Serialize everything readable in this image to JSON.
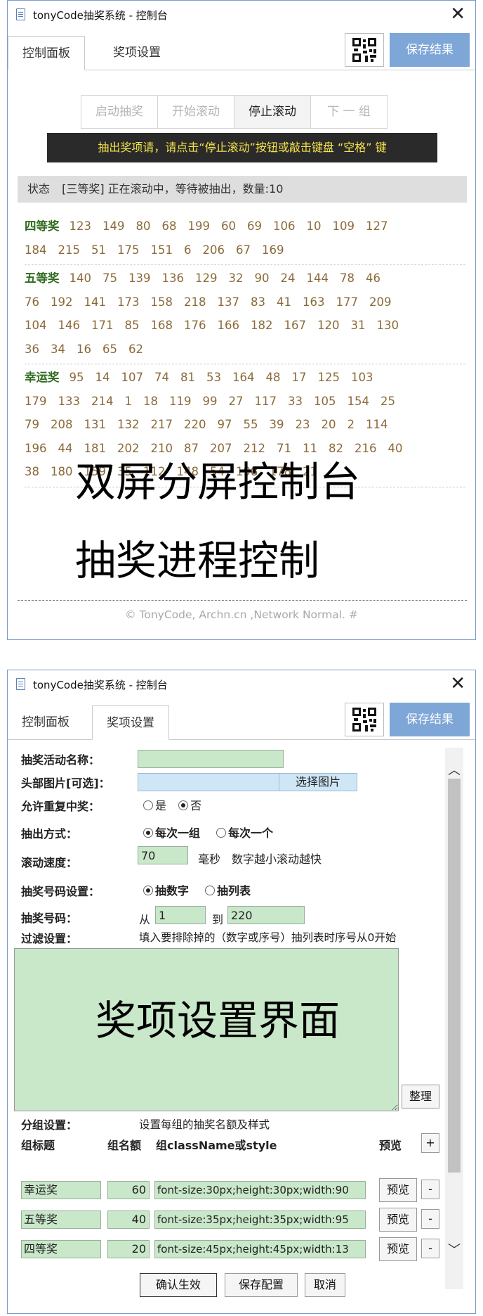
{
  "window_title": "tonyCode抽奖系统 - 控制台",
  "tabs": [
    "控制面板",
    "奖项设置"
  ],
  "save_button": "保存结果",
  "control": {
    "buttons": [
      "启动抽奖",
      "开始滚动",
      "停止滚动",
      "下 一 组"
    ],
    "active_button": "停止滚动",
    "notice": "抽出奖项请，请点击“停止滚动”按钮或敲击键盘 “空格” 键",
    "status_label": "状态",
    "status_text": "[三等奖] 正在滚动中，等待被抽出，数量:10",
    "groups": [
      {
        "name": "四等奖",
        "lines": [
          [
            "123",
            "149",
            "80",
            "68",
            "199",
            "60",
            "69",
            "106",
            "10",
            "109",
            "127"
          ],
          [
            "184",
            "215",
            "51",
            "175",
            "151",
            "6",
            "206",
            "67",
            "169"
          ]
        ]
      },
      {
        "name": "五等奖",
        "lines": [
          [
            "140",
            "75",
            "139",
            "136",
            "129",
            "32",
            "90",
            "24",
            "144",
            "78",
            "46"
          ],
          [
            "76",
            "192",
            "141",
            "173",
            "158",
            "218",
            "137",
            "83",
            "41",
            "163",
            "177",
            "209"
          ],
          [
            "104",
            "146",
            "171",
            "85",
            "168",
            "176",
            "166",
            "182",
            "167",
            "120",
            "31",
            "130"
          ],
          [
            "36",
            "34",
            "16",
            "65",
            "62"
          ]
        ]
      },
      {
        "name": "幸运奖",
        "lines": [
          [
            "95",
            "14",
            "107",
            "74",
            "81",
            "53",
            "164",
            "48",
            "17",
            "125",
            "103"
          ],
          [
            "179",
            "133",
            "214",
            "1",
            "18",
            "119",
            "99",
            "27",
            "117",
            "33",
            "105",
            "154",
            "25"
          ],
          [
            "79",
            "208",
            "131",
            "132",
            "217",
            "220",
            "97",
            "55",
            "39",
            "23",
            "20",
            "2",
            "114"
          ],
          [
            "196",
            "44",
            "181",
            "202",
            "210",
            "87",
            "207",
            "212",
            "71",
            "11",
            "82",
            "216",
            "40"
          ],
          [
            "38",
            "180",
            "159",
            "35",
            "112",
            "148",
            "54",
            "198",
            "178",
            "21"
          ]
        ]
      }
    ],
    "overlay_line1": "双屏分屏控制台",
    "overlay_line2": "抽奖进程控制",
    "footer": "© TonyCode, Archn.cn ,Network Normal. #"
  },
  "settings": {
    "name_label": "抽奖活动名称：",
    "name_value": "",
    "header_image_label": "头部图片[可选]：",
    "choose_image_button": "选择图片",
    "allow_repeat_label": "允许重复中奖：",
    "yes": "是",
    "no": "否",
    "draw_mode_label": "抽出方式：",
    "draw_mode_group": "每次一组",
    "draw_mode_single": "每次一个",
    "speed_label": "滚动速度：",
    "speed_value": "70",
    "speed_unit": "毫秒",
    "speed_hint": "数字越小滚动越快",
    "number_setting_label": "抽奖号码设置：",
    "by_number": "抽数字",
    "by_list": "抽列表",
    "number_label": "抽奖号码：",
    "from": "从",
    "from_value": "1",
    "to": "到",
    "to_value": "220",
    "filter_label": "过滤设置：",
    "filter_hint": "填入要排除掉的（数字或序号）抽列表时序号从0开始",
    "overlay_text": "奖项设置界面",
    "tidy_button": "整理",
    "group_setting_label": "分组设置：",
    "group_setting_hint": "设置每组的抽奖名额及样式",
    "col_title": "组标题",
    "col_quota": "组名额",
    "col_style": "组className或style",
    "col_preview": "预览",
    "add_button": "+",
    "rows": [
      {
        "title": "幸运奖",
        "quota": "60",
        "style": "font-size:30px;height:30px;width:90"
      },
      {
        "title": "五等奖",
        "quota": "40",
        "style": "font-size:35px;height:35px;width:95"
      },
      {
        "title": "四等奖",
        "quota": "20",
        "style": "font-size:45px;height:45px;width:13"
      }
    ],
    "preview_button": "预览",
    "remove_button": "-",
    "confirm_button": "确认生效",
    "save_config_button": "保存配置",
    "cancel_button": "取消"
  }
}
